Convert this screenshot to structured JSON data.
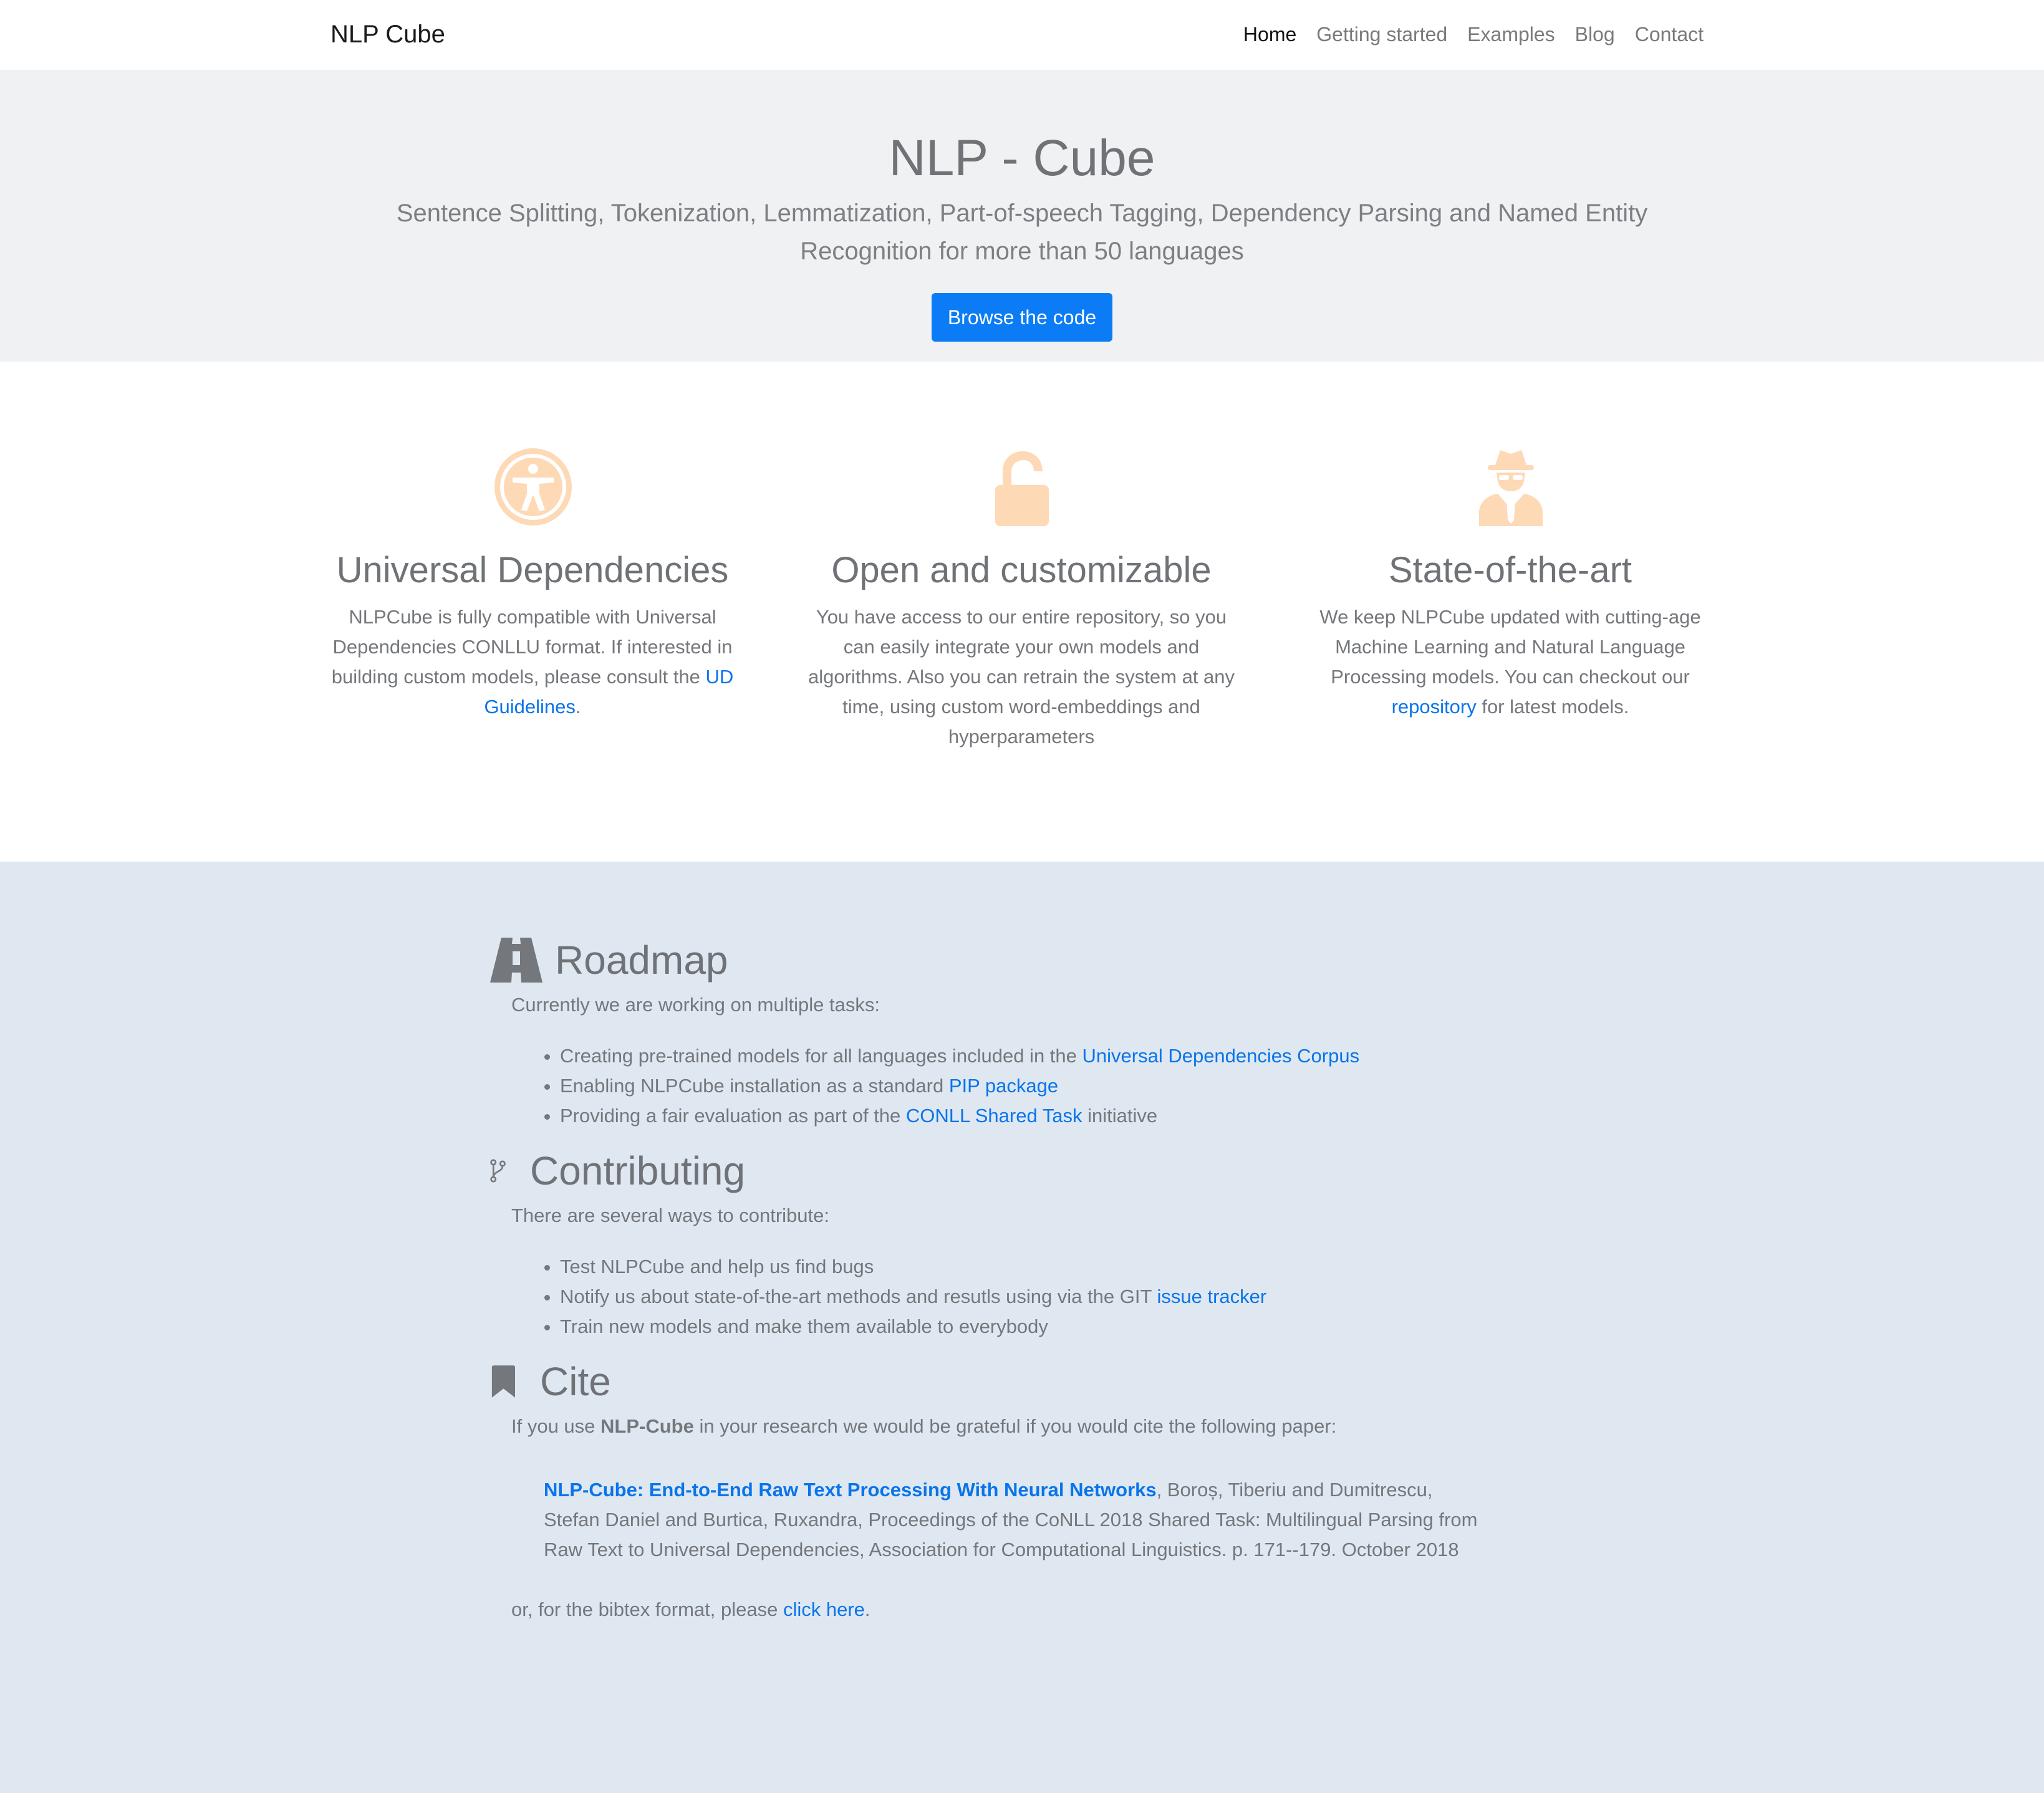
{
  "navbar": {
    "brand": "NLP Cube",
    "items": [
      {
        "label": "Home",
        "active": true
      },
      {
        "label": "Getting started",
        "active": false
      },
      {
        "label": "Examples",
        "active": false
      },
      {
        "label": "Blog",
        "active": false
      },
      {
        "label": "Contact",
        "active": false
      }
    ]
  },
  "hero": {
    "title": "NLP - Cube",
    "subtitle": "Sentence Splitting, Tokenization, Lemmatization, Part-of-speech Tagging, Dependency Parsing and Named Entity Recognition for more than 50 languages",
    "button": "Browse the code"
  },
  "features": [
    {
      "icon": "universal-access-icon",
      "title": "Universal Dependencies",
      "text": "NLPCube is fully compatible with Universal Dependencies CONLLU format. If interested in building custom models, please consult the ",
      "link": "UD Guidelines",
      "text_after": "."
    },
    {
      "icon": "unlock-icon",
      "title": "Open and customizable",
      "text": "You have access to our entire repository, so you can easily integrate your own models and algorithms. Also you can retrain the system at any time, using custom word-embeddings and hyperparameters",
      "link": "",
      "text_after": ""
    },
    {
      "icon": "user-secret-icon",
      "title": "State-of-the-art",
      "text": "We keep NLPCube updated with cutting-age Machine Learning and Natural Language Processing models. You can checkout our ",
      "link": "repository",
      "text_after": " for latest models."
    }
  ],
  "roadmap": {
    "title": "Roadmap",
    "intro": "Currently we are working on multiple tasks:",
    "items": [
      {
        "before": "Creating pre-trained models for all languages included in the ",
        "link": "Universal Dependencies Corpus",
        "after": ""
      },
      {
        "before": "Enabling NLPCube installation as a standard ",
        "link": "PIP package",
        "after": ""
      },
      {
        "before": "Providing a fair evaluation as part of the ",
        "link": "CONLL Shared Task",
        "after": " initiative"
      }
    ]
  },
  "contributing": {
    "title": "Contributing",
    "intro": "There are several ways to contribute:",
    "items": [
      {
        "before": "Test NLPCube and help us find bugs",
        "link": "",
        "after": ""
      },
      {
        "before": "Notify us about state-of-the-art methods and resutls using via the GIT ",
        "link": "issue tracker",
        "after": ""
      },
      {
        "before": "Train new models and make them available to everybody",
        "link": "",
        "after": ""
      }
    ]
  },
  "cite": {
    "title": "Cite",
    "intro_before": "If you use ",
    "intro_bold": "NLP-Cube",
    "intro_after": " in your research we would be grateful if you would cite the following paper:",
    "paper_title": "NLP-Cube: End-to-End Raw Text Processing With Neural Networks",
    "paper_rest": ", Boroș, Tiberiu and Dumitrescu, Stefan Daniel and Burtica, Ruxandra, Proceedings of the CoNLL 2018 Shared Task: Multilingual Parsing from Raw Text to Universal Dependencies, Association for Computational Linguistics. p. 171--179. October 2018",
    "bib_before": "or, for the bibtex format, please ",
    "bib_link": "click here",
    "bib_after": "."
  },
  "colors": {
    "accent": "#0b7cf5",
    "link": "#0a74ea",
    "feature_icon": "#fdd9b5",
    "section_bg": "#dfe8f1",
    "hero_bg": "#f0f1f3"
  }
}
